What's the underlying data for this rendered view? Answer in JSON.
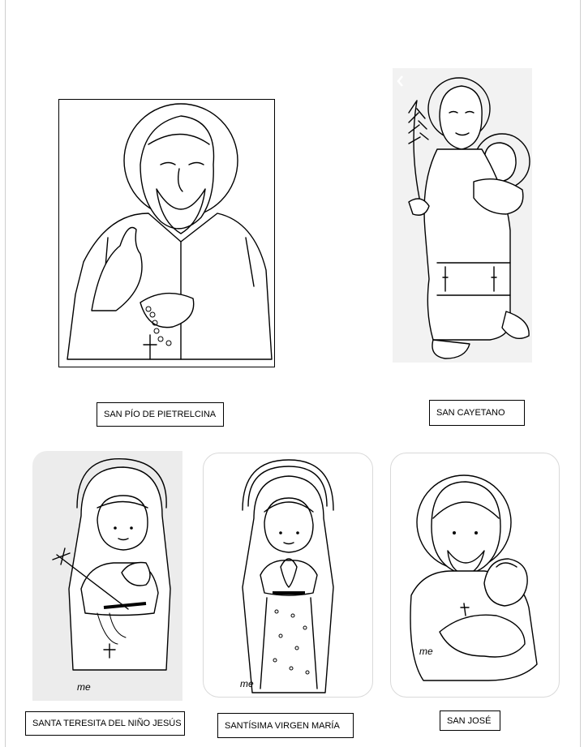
{
  "labels": {
    "pio": "SAN PÍO DE PIETRELCINA",
    "cayetano": "SAN CAYETANO",
    "teresita": "SANTA TERESITA DEL NIÑO JESÚS",
    "virgen": "SANTÍSIMA VIRGEN MARÍA",
    "jose": "SAN JOSÉ"
  },
  "signatures": {
    "teresita": "me",
    "virgen": "me",
    "jose": "me"
  }
}
